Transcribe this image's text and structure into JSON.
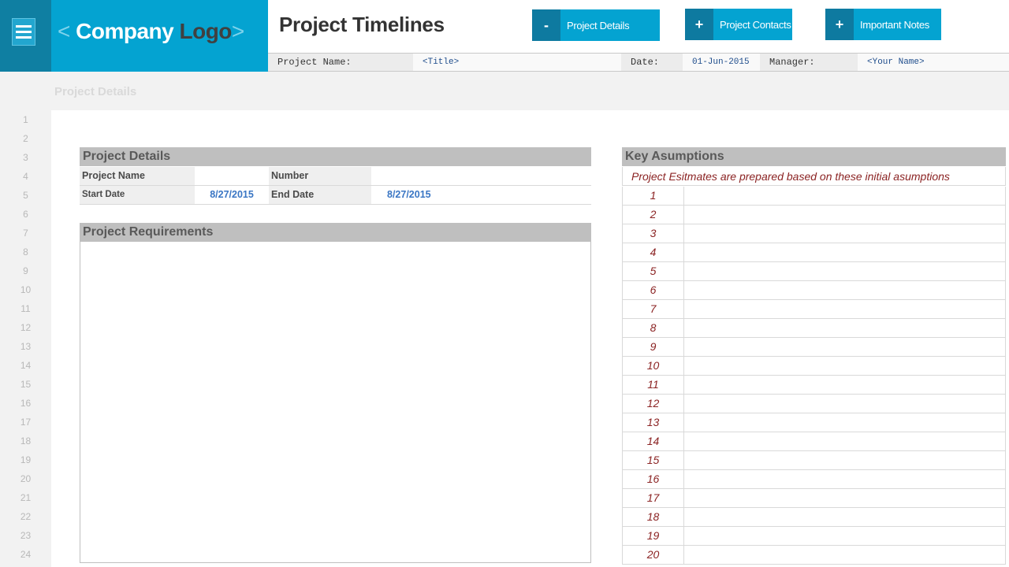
{
  "header": {
    "logo_left_chevron": "<",
    "logo_word1": "Company",
    "logo_word2": "Logo",
    "logo_right_chevron": ">",
    "title": "Project Timelines",
    "buttons": [
      {
        "symbol": "-",
        "label": "Project Details"
      },
      {
        "symbol": "+",
        "label": "Project Contacts"
      },
      {
        "symbol": "+",
        "label": "Important Notes"
      }
    ]
  },
  "infobar": {
    "project_name_label": "Project Name:",
    "project_name_value": "<Title>",
    "date_label": "Date:",
    "date_value": "01-Jun-2015",
    "manager_label": "Manager:",
    "manager_value": "<Your Name>"
  },
  "sheet": {
    "section_label": "Project Details",
    "row_numbers": [
      "1",
      "2",
      "3",
      "4",
      "5",
      "6",
      "7",
      "8",
      "9",
      "10",
      "11",
      "12",
      "13",
      "14",
      "15",
      "16",
      "17",
      "18",
      "19",
      "20",
      "21",
      "22",
      "23",
      "24"
    ]
  },
  "project_details": {
    "heading": "Project Details",
    "project_name_label": "Project Name",
    "project_name_value": "",
    "number_label": "Number",
    "number_value": "",
    "start_date_label": "Start Date",
    "start_date_value": "8/27/2015",
    "end_date_label": "End Date",
    "end_date_value": "8/27/2015"
  },
  "requirements": {
    "heading": "Project Requirements"
  },
  "assumptions": {
    "heading": "Key Asumptions",
    "subtitle": "Project Esitmates are prepared based on these initial asumptions",
    "items": [
      {
        "num": "1",
        "text": ""
      },
      {
        "num": "2",
        "text": ""
      },
      {
        "num": "3",
        "text": ""
      },
      {
        "num": "4",
        "text": ""
      },
      {
        "num": "5",
        "text": ""
      },
      {
        "num": "6",
        "text": ""
      },
      {
        "num": "7",
        "text": ""
      },
      {
        "num": "8",
        "text": ""
      },
      {
        "num": "9",
        "text": ""
      },
      {
        "num": "10",
        "text": ""
      },
      {
        "num": "11",
        "text": ""
      },
      {
        "num": "12",
        "text": ""
      },
      {
        "num": "13",
        "text": ""
      },
      {
        "num": "14",
        "text": ""
      },
      {
        "num": "15",
        "text": ""
      },
      {
        "num": "16",
        "text": ""
      },
      {
        "num": "17",
        "text": ""
      },
      {
        "num": "18",
        "text": ""
      },
      {
        "num": "19",
        "text": ""
      },
      {
        "num": "20",
        "text": ""
      }
    ]
  },
  "colors": {
    "brand_blue": "#04a3d1",
    "brand_dark_blue": "#0f7fa2",
    "assumption_text": "#8b2323",
    "date_value": "#3a76c4"
  }
}
